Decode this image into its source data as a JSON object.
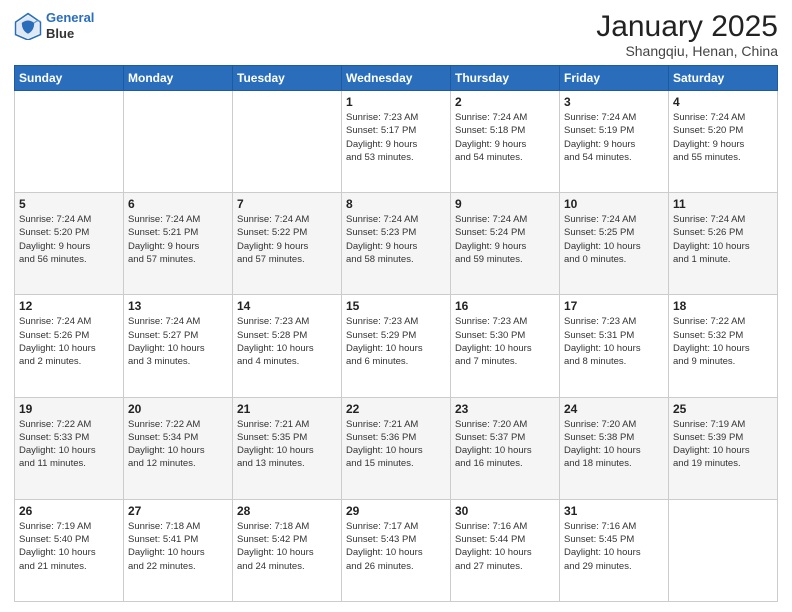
{
  "logo": {
    "line1": "General",
    "line2": "Blue"
  },
  "title": "January 2025",
  "subtitle": "Shangqiu, Henan, China",
  "days_header": [
    "Sunday",
    "Monday",
    "Tuesday",
    "Wednesday",
    "Thursday",
    "Friday",
    "Saturday"
  ],
  "weeks": [
    [
      {
        "day": "",
        "info": ""
      },
      {
        "day": "",
        "info": ""
      },
      {
        "day": "",
        "info": ""
      },
      {
        "day": "1",
        "info": "Sunrise: 7:23 AM\nSunset: 5:17 PM\nDaylight: 9 hours\nand 53 minutes."
      },
      {
        "day": "2",
        "info": "Sunrise: 7:24 AM\nSunset: 5:18 PM\nDaylight: 9 hours\nand 54 minutes."
      },
      {
        "day": "3",
        "info": "Sunrise: 7:24 AM\nSunset: 5:19 PM\nDaylight: 9 hours\nand 54 minutes."
      },
      {
        "day": "4",
        "info": "Sunrise: 7:24 AM\nSunset: 5:20 PM\nDaylight: 9 hours\nand 55 minutes."
      }
    ],
    [
      {
        "day": "5",
        "info": "Sunrise: 7:24 AM\nSunset: 5:20 PM\nDaylight: 9 hours\nand 56 minutes."
      },
      {
        "day": "6",
        "info": "Sunrise: 7:24 AM\nSunset: 5:21 PM\nDaylight: 9 hours\nand 57 minutes."
      },
      {
        "day": "7",
        "info": "Sunrise: 7:24 AM\nSunset: 5:22 PM\nDaylight: 9 hours\nand 57 minutes."
      },
      {
        "day": "8",
        "info": "Sunrise: 7:24 AM\nSunset: 5:23 PM\nDaylight: 9 hours\nand 58 minutes."
      },
      {
        "day": "9",
        "info": "Sunrise: 7:24 AM\nSunset: 5:24 PM\nDaylight: 9 hours\nand 59 minutes."
      },
      {
        "day": "10",
        "info": "Sunrise: 7:24 AM\nSunset: 5:25 PM\nDaylight: 10 hours\nand 0 minutes."
      },
      {
        "day": "11",
        "info": "Sunrise: 7:24 AM\nSunset: 5:26 PM\nDaylight: 10 hours\nand 1 minute."
      }
    ],
    [
      {
        "day": "12",
        "info": "Sunrise: 7:24 AM\nSunset: 5:26 PM\nDaylight: 10 hours\nand 2 minutes."
      },
      {
        "day": "13",
        "info": "Sunrise: 7:24 AM\nSunset: 5:27 PM\nDaylight: 10 hours\nand 3 minutes."
      },
      {
        "day": "14",
        "info": "Sunrise: 7:23 AM\nSunset: 5:28 PM\nDaylight: 10 hours\nand 4 minutes."
      },
      {
        "day": "15",
        "info": "Sunrise: 7:23 AM\nSunset: 5:29 PM\nDaylight: 10 hours\nand 6 minutes."
      },
      {
        "day": "16",
        "info": "Sunrise: 7:23 AM\nSunset: 5:30 PM\nDaylight: 10 hours\nand 7 minutes."
      },
      {
        "day": "17",
        "info": "Sunrise: 7:23 AM\nSunset: 5:31 PM\nDaylight: 10 hours\nand 8 minutes."
      },
      {
        "day": "18",
        "info": "Sunrise: 7:22 AM\nSunset: 5:32 PM\nDaylight: 10 hours\nand 9 minutes."
      }
    ],
    [
      {
        "day": "19",
        "info": "Sunrise: 7:22 AM\nSunset: 5:33 PM\nDaylight: 10 hours\nand 11 minutes."
      },
      {
        "day": "20",
        "info": "Sunrise: 7:22 AM\nSunset: 5:34 PM\nDaylight: 10 hours\nand 12 minutes."
      },
      {
        "day": "21",
        "info": "Sunrise: 7:21 AM\nSunset: 5:35 PM\nDaylight: 10 hours\nand 13 minutes."
      },
      {
        "day": "22",
        "info": "Sunrise: 7:21 AM\nSunset: 5:36 PM\nDaylight: 10 hours\nand 15 minutes."
      },
      {
        "day": "23",
        "info": "Sunrise: 7:20 AM\nSunset: 5:37 PM\nDaylight: 10 hours\nand 16 minutes."
      },
      {
        "day": "24",
        "info": "Sunrise: 7:20 AM\nSunset: 5:38 PM\nDaylight: 10 hours\nand 18 minutes."
      },
      {
        "day": "25",
        "info": "Sunrise: 7:19 AM\nSunset: 5:39 PM\nDaylight: 10 hours\nand 19 minutes."
      }
    ],
    [
      {
        "day": "26",
        "info": "Sunrise: 7:19 AM\nSunset: 5:40 PM\nDaylight: 10 hours\nand 21 minutes."
      },
      {
        "day": "27",
        "info": "Sunrise: 7:18 AM\nSunset: 5:41 PM\nDaylight: 10 hours\nand 22 minutes."
      },
      {
        "day": "28",
        "info": "Sunrise: 7:18 AM\nSunset: 5:42 PM\nDaylight: 10 hours\nand 24 minutes."
      },
      {
        "day": "29",
        "info": "Sunrise: 7:17 AM\nSunset: 5:43 PM\nDaylight: 10 hours\nand 26 minutes."
      },
      {
        "day": "30",
        "info": "Sunrise: 7:16 AM\nSunset: 5:44 PM\nDaylight: 10 hours\nand 27 minutes."
      },
      {
        "day": "31",
        "info": "Sunrise: 7:16 AM\nSunset: 5:45 PM\nDaylight: 10 hours\nand 29 minutes."
      },
      {
        "day": "",
        "info": ""
      }
    ]
  ]
}
